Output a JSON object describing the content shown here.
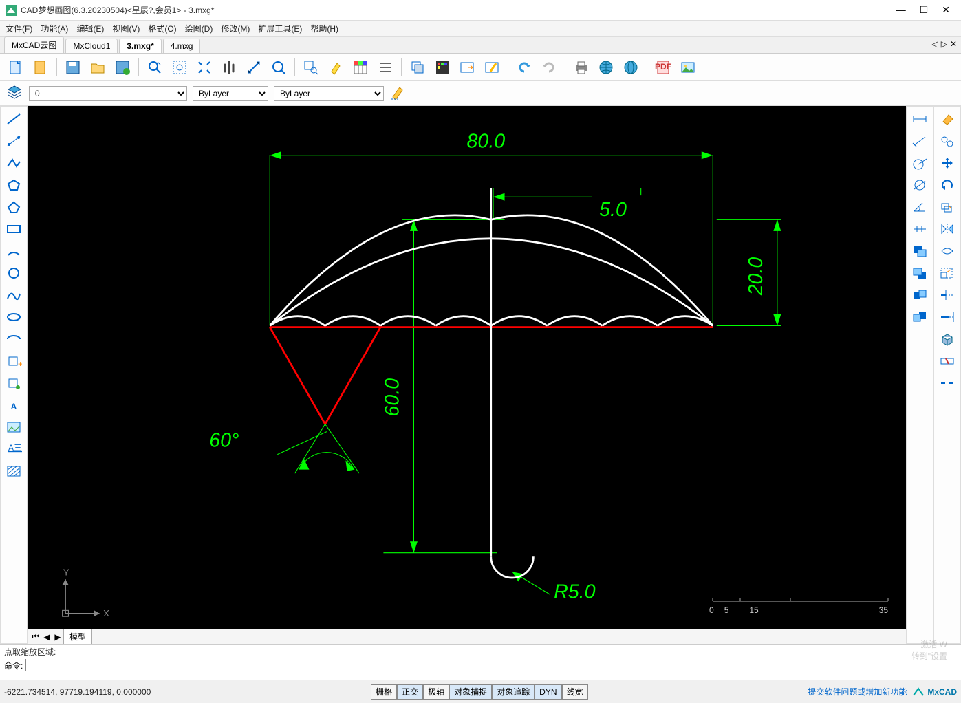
{
  "app": {
    "title": "CAD梦想画图(6.3.20230504)<星辰?,会员1> - 3.mxg*"
  },
  "menu": [
    "文件(F)",
    "功能(A)",
    "编辑(E)",
    "视图(V)",
    "格式(O)",
    "绘图(D)",
    "修改(M)",
    "扩展工具(E)",
    "帮助(H)"
  ],
  "tabs": [
    {
      "label": "MxCAD云图",
      "active": false
    },
    {
      "label": "MxCloud1",
      "active": false
    },
    {
      "label": "3.mxg*",
      "active": true
    },
    {
      "label": "4.mxg",
      "active": false
    }
  ],
  "layerbar": {
    "layer_value": "0",
    "color_value": "ByLayer",
    "linetype_value": "ByLayer"
  },
  "drawing": {
    "dim_top": "80.0",
    "dim_5": "5.0",
    "dim_20": "20.0",
    "dim_60h": "60.0",
    "dim_angle": "60°",
    "dim_r5": "R5.0",
    "ruler_0": "0",
    "ruler_5": "5",
    "ruler_15": "15",
    "ruler_35": "35"
  },
  "modeltab": "模型",
  "cmd": {
    "prompt": "点取缩放区域:",
    "label": "命令:",
    "input": ""
  },
  "status": {
    "coords": "-6221.734514,  97719.194119,  0.000000",
    "buttons": [
      "栅格",
      "正交",
      "极轴",
      "对象捕捉",
      "对象追踪",
      "DYN",
      "线宽"
    ],
    "feedback": "提交软件问题或增加新功能",
    "brand": "MxCAD"
  },
  "watermark": {
    "l1": "激活 W",
    "l2": "转到\"设置"
  }
}
